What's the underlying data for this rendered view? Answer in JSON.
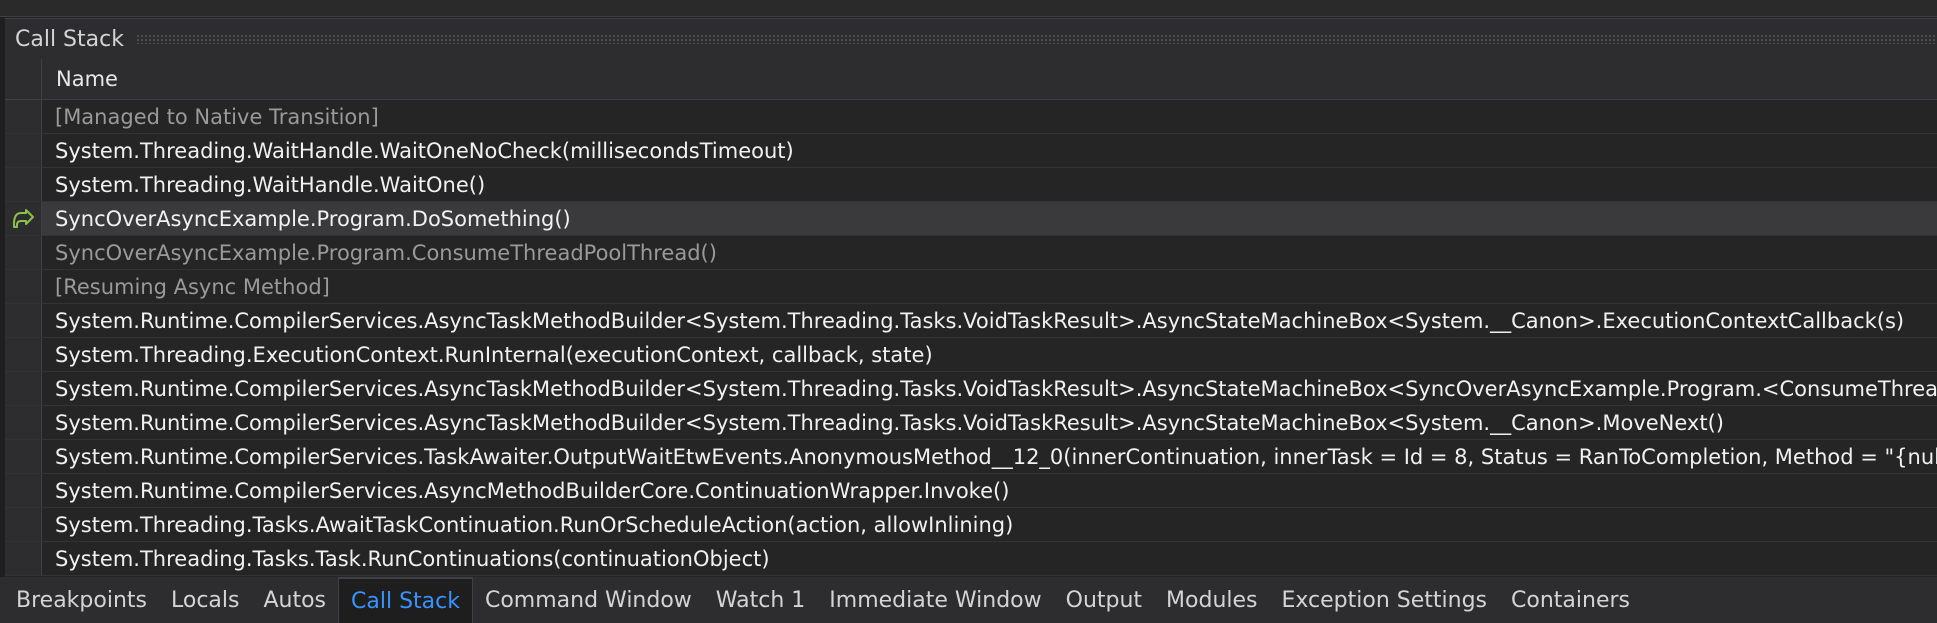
{
  "panel": {
    "title": "Call Stack"
  },
  "columns": {
    "name": "Name"
  },
  "frames": [
    {
      "text": "[Managed to Native Transition]",
      "dim": true,
      "current": false
    },
    {
      "text": "System.Threading.WaitHandle.WaitOneNoCheck(millisecondsTimeout)",
      "dim": false,
      "current": false
    },
    {
      "text": "System.Threading.WaitHandle.WaitOne()",
      "dim": false,
      "current": false
    },
    {
      "text": "SyncOverAsyncExample.Program.DoSomething()",
      "dim": false,
      "current": true
    },
    {
      "text": "SyncOverAsyncExample.Program.ConsumeThreadPoolThread()",
      "dim": true,
      "current": false
    },
    {
      "text": "[Resuming Async Method]",
      "dim": true,
      "current": false
    },
    {
      "text": "System.Runtime.CompilerServices.AsyncTaskMethodBuilder<System.Threading.Tasks.VoidTaskResult>.AsyncStateMachineBox<System.__Canon>.ExecutionContextCallback(s)",
      "dim": false,
      "current": false
    },
    {
      "text": "System.Threading.ExecutionContext.RunInternal(executionContext, callback, state)",
      "dim": false,
      "current": false
    },
    {
      "text": "System.Runtime.CompilerServices.AsyncTaskMethodBuilder<System.Threading.Tasks.VoidTaskResult>.AsyncStateMachineBox<SyncOverAsyncExample.Program.<ConsumeThread",
      "dim": false,
      "current": false
    },
    {
      "text": "System.Runtime.CompilerServices.AsyncTaskMethodBuilder<System.Threading.Tasks.VoidTaskResult>.AsyncStateMachineBox<System.__Canon>.MoveNext()",
      "dim": false,
      "current": false
    },
    {
      "text": "System.Runtime.CompilerServices.TaskAwaiter.OutputWaitEtwEvents.AnonymousMethod__12_0(innerContinuation, innerTask = Id = 8, Status = RanToCompletion, Method = \"{null",
      "dim": false,
      "current": false
    },
    {
      "text": "System.Runtime.CompilerServices.AsyncMethodBuilderCore.ContinuationWrapper.Invoke()",
      "dim": false,
      "current": false
    },
    {
      "text": "System.Threading.Tasks.AwaitTaskContinuation.RunOrScheduleAction(action, allowInlining)",
      "dim": false,
      "current": false
    },
    {
      "text": "System.Threading.Tasks.Task.RunContinuations(continuationObject)",
      "dim": false,
      "current": false
    }
  ],
  "tabs": [
    {
      "label": "Breakpoints",
      "active": false
    },
    {
      "label": "Locals",
      "active": false
    },
    {
      "label": "Autos",
      "active": false
    },
    {
      "label": "Call Stack",
      "active": true
    },
    {
      "label": "Command Window",
      "active": false
    },
    {
      "label": "Watch 1",
      "active": false
    },
    {
      "label": "Immediate Window",
      "active": false
    },
    {
      "label": "Output",
      "active": false
    },
    {
      "label": "Modules",
      "active": false
    },
    {
      "label": "Exception Settings",
      "active": false
    },
    {
      "label": "Containers",
      "active": false
    }
  ],
  "colors": {
    "accent": "#3794ff",
    "current_frame_arrow": "#8bc34a",
    "dim_text": "#9a9a9a"
  },
  "icons": {
    "current_frame": "current-frame-arrow-icon"
  }
}
